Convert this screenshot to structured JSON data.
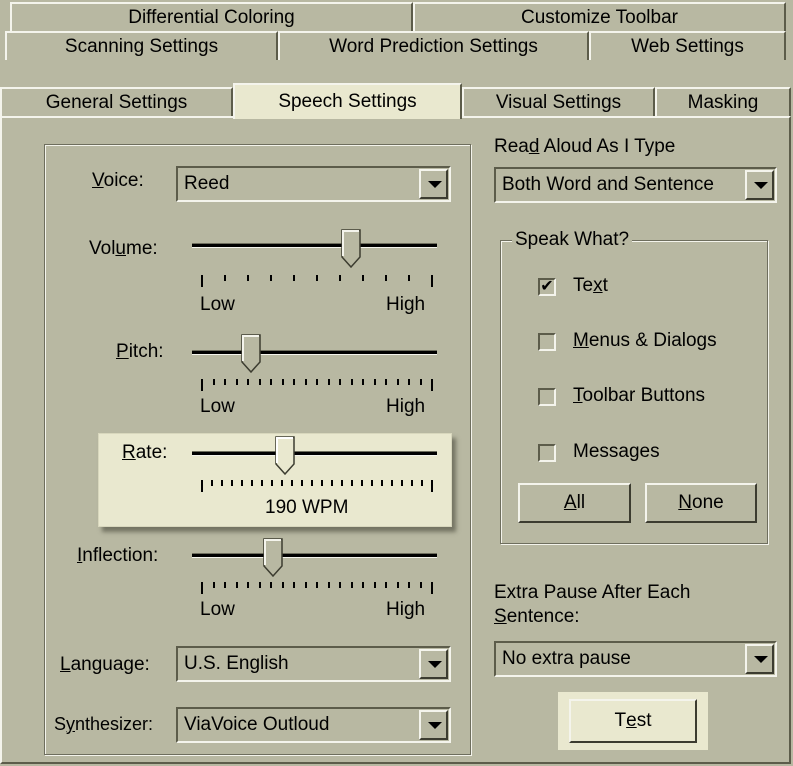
{
  "tabs": {
    "row1": [
      "Differential Coloring",
      "Customize Toolbar"
    ],
    "row2": [
      "Scanning Settings",
      "Word Prediction Settings",
      "Web Settings"
    ],
    "row3": [
      "General Settings",
      "Speech Settings",
      "Visual Settings",
      "Masking"
    ],
    "selected": "Speech Settings"
  },
  "voice": {
    "label_u": "V",
    "label_rest": "oice:",
    "value": "Reed"
  },
  "volume": {
    "label_a": "Vol",
    "label_u": "u",
    "label_b": "me:",
    "low": "Low",
    "high": "High",
    "level": 0.65
  },
  "pitch": {
    "label_u": "P",
    "label_rest": "itch:",
    "low": "Low",
    "high": "High",
    "level": 0.24
  },
  "rate": {
    "label_u": "R",
    "label_rest": "ate:",
    "readout": "190 WPM",
    "level": 0.38
  },
  "inflection": {
    "label_u": "I",
    "label_rest": "nflection:",
    "low": "Low",
    "high": "High",
    "level": 0.33
  },
  "language": {
    "label_u": "L",
    "label_rest": "anguage:",
    "value": "U.S. English"
  },
  "synthesizer": {
    "label_a": "S",
    "label_u": "y",
    "label_b": "nthesizer:",
    "value": "ViaVoice Outloud"
  },
  "read_aloud": {
    "label_a": "Rea",
    "label_u": "d",
    "label_b": " Aloud As I Type",
    "value": "Both Word and Sentence"
  },
  "speak_what": {
    "title": "Speak What?",
    "items": [
      {
        "a": "Te",
        "u": "x",
        "b": "t",
        "checked": true
      },
      {
        "a": "",
        "u": "M",
        "b": "enus & Dialogs",
        "checked": false
      },
      {
        "a": "",
        "u": "T",
        "b": "oolbar Buttons",
        "checked": false
      },
      {
        "a": "Messa",
        "u": "g",
        "b": "es",
        "checked": false
      }
    ],
    "all_u": "A",
    "all_rest": "ll",
    "none_u": "N",
    "none_rest": "one"
  },
  "extra_pause": {
    "line1": "Extra Pause After Each",
    "line2_u": "S",
    "line2_rest": "entence:",
    "value": "No extra pause"
  },
  "test": {
    "a": "T",
    "u": "e",
    "b": "st"
  },
  "colors": {
    "face": "#b8b8a2",
    "highlight": "#e9e8cf",
    "shadow": "#5c5c4a"
  }
}
